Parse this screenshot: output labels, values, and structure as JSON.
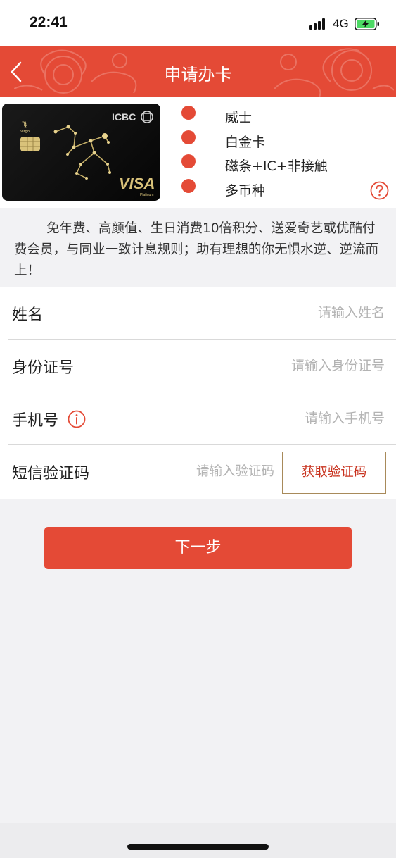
{
  "status_bar": {
    "time": "22:41",
    "network": "4G",
    "battery_color": "#4cd964"
  },
  "header": {
    "title": "申请办卡",
    "background_color": "#e44a36"
  },
  "card": {
    "bank_logo_text": "ICBC",
    "network_logo_text": "VISA",
    "tier_text": "Platinum",
    "constellation_text": "Virgo",
    "features": [
      {
        "label": "威士"
      },
      {
        "label": "白金卡"
      },
      {
        "label": "磁条+IC+非接触"
      },
      {
        "label": "多币种"
      }
    ]
  },
  "description": "免年费、高颜值、生日消费10倍积分、送爱奇艺或优酷付费会员，与同业一致计息规则；助有理想的你无惧水逆、逆流而上！",
  "form": {
    "name": {
      "label": "姓名",
      "placeholder": "请输入姓名",
      "value": ""
    },
    "id_number": {
      "label": "身份证号",
      "placeholder": "请输入身份证号",
      "value": ""
    },
    "phone": {
      "label": "手机号",
      "placeholder": "请输入手机号",
      "value": ""
    },
    "sms_code": {
      "label": "短信验证码",
      "placeholder": "请输入验证码",
      "value": "",
      "button_label": "获取验证码"
    }
  },
  "next_button": {
    "label": "下一步"
  },
  "icons": {
    "back": "chevron-left-icon",
    "help": "question-circle-icon",
    "info": "info-circle-icon"
  }
}
